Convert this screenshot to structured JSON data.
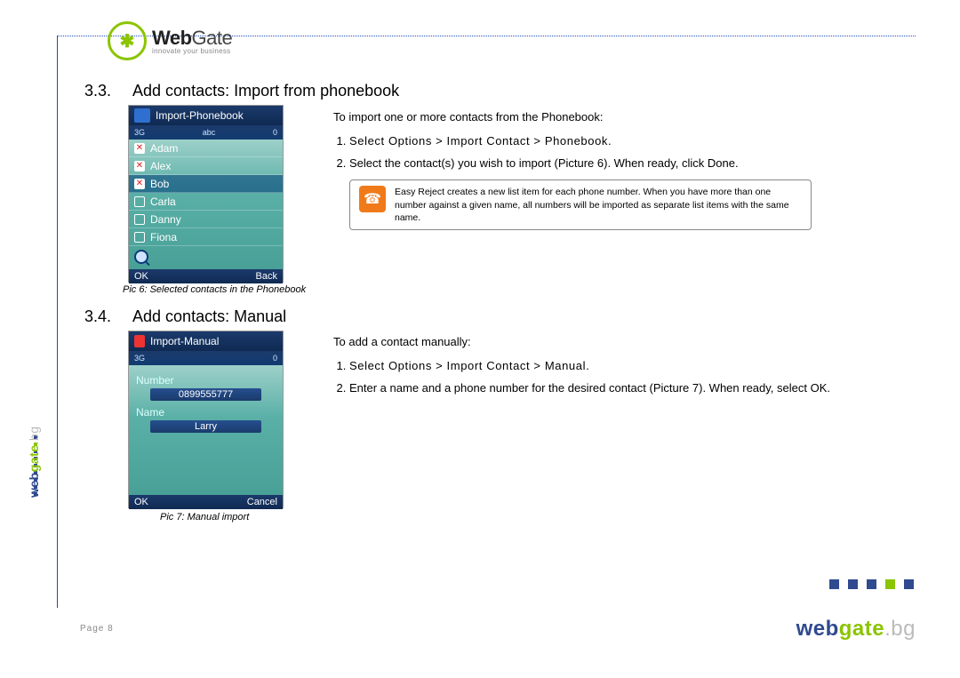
{
  "brand": {
    "main": "WebGate",
    "tagline": "innovate your business",
    "side": {
      "web": "web",
      "gate": "gate",
      "bg": ".bg"
    }
  },
  "section33": {
    "number": "3.3.",
    "title": "Add contacts: Import from phonebook"
  },
  "section34": {
    "number": "3.4.",
    "title": "Add contacts: Manual"
  },
  "phone1": {
    "title": "Import-Phonebook",
    "status_left": "3G",
    "status_mid": "abc",
    "status_right": "0",
    "contacts": [
      {
        "name": "Adam",
        "checked": true
      },
      {
        "name": "Alex",
        "checked": true
      },
      {
        "name": "Bob",
        "checked": true,
        "selected": true
      },
      {
        "name": "Carla",
        "checked": false
      },
      {
        "name": "Danny",
        "checked": false
      },
      {
        "name": "Fiona",
        "checked": false
      }
    ],
    "soft_left": "OK",
    "soft_right": "Back",
    "caption": "Pic 6: Selected contacts in the Phonebook"
  },
  "phone2": {
    "title": "Import-Manual",
    "status_left": "3G",
    "status_right": "0",
    "number_label": "Number",
    "number_value": "0899555777",
    "name_label": "Name",
    "name_value": "Larry",
    "soft_left": "OK",
    "soft_right": "Cancel",
    "caption": "Pic 7: Manual import"
  },
  "instr33": {
    "intro": "To import one or more contacts from the Phonebook:",
    "step1": "Select Options > Import Contact > Phonebook.",
    "step2": "Select the contact(s) you wish to import (Picture 6). When ready, click Done.",
    "note": "Easy Reject creates a new list item for each phone number. When you have more than one number against a given name, all numbers will be imported as separate list items with the same name."
  },
  "instr34": {
    "intro": "To add a contact manually:",
    "step1": "Select Options > Import Contact > Manual.",
    "step2": "Enter a name and a phone number for the desired contact (Picture 7). When ready, select OK."
  },
  "footer": {
    "page": "Page 8"
  }
}
